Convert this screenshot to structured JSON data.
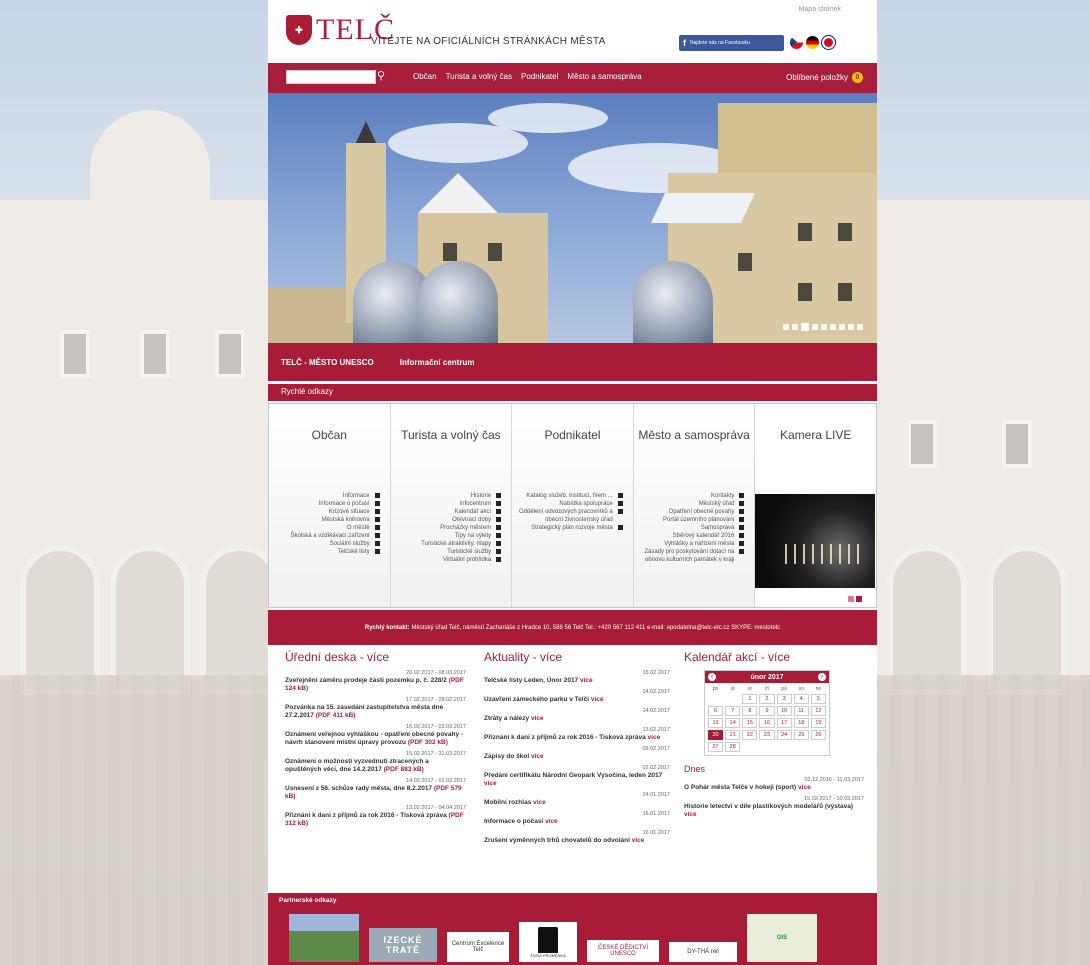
{
  "header": {
    "mapa_label": "Mapa stránek",
    "logo_shield": "TELČ",
    "logo_text": "TELČ",
    "welcome": "VÍTEJTE NA OFICIÁLNÍCH STRÁNKÁCH MĚSTA",
    "facebook_label": "Najdete nás na Facebooku"
  },
  "nav": {
    "search_value": "",
    "links": [
      "Občan",
      "Turista a volný čas",
      "Podnikatel",
      "Město a samospráva"
    ],
    "favorites_label": "Oblíbené položky",
    "favorites_count": "0"
  },
  "hero": {
    "slide_count": 9,
    "active_index": 2
  },
  "unesco_bar": {
    "link1": "TELČ - MĚSTO UNESCO",
    "link2": "Informační centrum"
  },
  "quick_links": {
    "heading": "Rychlé odkazy",
    "columns": [
      {
        "title": "Občan",
        "items": [
          "Informace",
          "Informace o počasí",
          "Krizové situace",
          "Městská knihovna",
          "O městě",
          "Školská a vzdělávací zařízení",
          "Sociální služby",
          "Telčské listy"
        ]
      },
      {
        "title": "Turista a volný čas",
        "items": [
          "Historie",
          "Infocentrum",
          "Kalendář akcí",
          "Otevírací doby",
          "Procházky městem",
          "Tipy na výlety",
          "Turistické atraktivity, mapy",
          "Turistické služby",
          "Virtuální prohlídka"
        ]
      },
      {
        "title": "Podnikatel",
        "items": [
          "Katalog služeb, institucí, firem ...",
          "Nabídka spolupráce",
          "Oddělení odvozových pracovníků a obecní živnostenský úřad",
          "Strategický plán rozvoje města"
        ]
      },
      {
        "title": "Město a samospráva",
        "items": [
          "Kontakty",
          "Městský úřad",
          "Opatření obecné povahy",
          "Portál územního plánování",
          "Samospráva",
          "Sběrový kalendář 2016",
          "Vyhlášky a nařízení města",
          "Zásady pro poskytování dotací na obnovu kulturních památek v kraji"
        ]
      },
      {
        "title": "Kamera LIVE",
        "items": []
      }
    ]
  },
  "contact": {
    "label": "Rychlý kontakt:",
    "text": "Městský úřad Telč, náměstí Zachariáše z Hradce 10, 588 56 Telč Tel.: +420 567 112 411 e-mail: epodatelna@telc-etc.cz SKYPE: mestotelc"
  },
  "uredni_deska": {
    "title": "Úřední deska - více",
    "entries": [
      {
        "date": "20.02.2017 - 08.03.2017",
        "title": "Zveřejnění záměru prodeje části pozemku p. č. 228/2",
        "pdf": "(PDF 124 kB)"
      },
      {
        "date": "17.02.2017 - 28.02.2017",
        "title": "Pozvánka na 15. zasedání zastupitelstva města dne 27.2.2017",
        "pdf": "(PDF 411 kB)"
      },
      {
        "date": "16.02.2017 - 03.03.2017",
        "title": "Oznámení veřejnou vyhláškou - opatření obecné povahy - návrh stanovení místní úpravy provozu",
        "pdf": "(PDF 302 kB)"
      },
      {
        "date": "15.02.2017 - 31.03.2017",
        "title": "Oznámení o možnosti vyzvednutí ztracených a opuštěných věcí, dne 14.2.2017",
        "pdf": "(PDF 883 kB)"
      },
      {
        "date": "14.02.2017 - 01.03.2017",
        "title": "Usnesení z 56. schůze rady města, dne 8.2.2017",
        "pdf": "(PDF 579 kB)"
      },
      {
        "date": "13.02.2017 - 04.04.2017",
        "title": "Přiznání k dani z příjmů za rok 2016 - Tisková zpráva",
        "pdf": "(PDF 312 kB)"
      }
    ]
  },
  "aktuality": {
    "title": "Aktuality - více",
    "vice": "více",
    "entries": [
      {
        "date": "15.02.2017",
        "title": "Telčské listy Leden, Únor 2017"
      },
      {
        "date": "14.02.2017",
        "title": "Uzavření zámeckého parku v Telči"
      },
      {
        "date": "14.02.2017",
        "title": "Ztráty a nálezy"
      },
      {
        "date": "13.02.2017",
        "title": "Přiznání k dani z příjmů za rok 2016 - Tisková zpráva"
      },
      {
        "date": "09.02.2017",
        "title": "Zápisy do škol"
      },
      {
        "date": "02.02.2017",
        "title": "Předání certifikátu Národní Geopark Vysočina, leden 2017"
      },
      {
        "date": "24.01.2017",
        "title": "Mobilní rozhlas"
      },
      {
        "date": "16.01.2017",
        "title": "Informace o počasí"
      },
      {
        "date": "16.01.2017",
        "title": "Zrušení výměnných trhů chovatelů do odvolání"
      }
    ]
  },
  "kalendar": {
    "title": "Kalendář akcí - více",
    "month": "únor 2017",
    "prev": "‹",
    "next": "›",
    "dow": [
      "po",
      "út",
      "st",
      "čt",
      "pá",
      "so",
      "ne"
    ],
    "days": [
      "",
      "",
      "1",
      "2",
      "3",
      "4",
      "5",
      "6",
      "7",
      "8",
      "9",
      "10",
      "11",
      "12",
      "13",
      "14",
      "15",
      "16",
      "17",
      "18",
      "19",
      "20",
      "21",
      "22",
      "23",
      "24",
      "25",
      "26",
      "27",
      "28",
      "",
      "",
      "",
      "",
      ""
    ],
    "today": "20",
    "dnes_title": "Dnes",
    "dnes": [
      {
        "date": "02.12.2016 - 11.03.2017",
        "title": "O Pohár města Telče v hokeji (sport)"
      },
      {
        "date": "15.02.2017 - 10.03.2017",
        "title": "Historie letectví v díle plastikových modelářů (výstava)"
      }
    ]
  },
  "partners": {
    "title": "Partnerské odkazy",
    "logos": [
      "",
      "IZECKÉ TRATĚ",
      "Centrum Excelence Telč",
      "ŽIVNÁ PROMĚNKA",
      "ČESKÉ DĚDICTVÍ UNESCO",
      "DY-THÁ reil",
      "GIS"
    ]
  },
  "colors": {
    "brand": "#a81c38",
    "facebook": "#3b5998"
  }
}
